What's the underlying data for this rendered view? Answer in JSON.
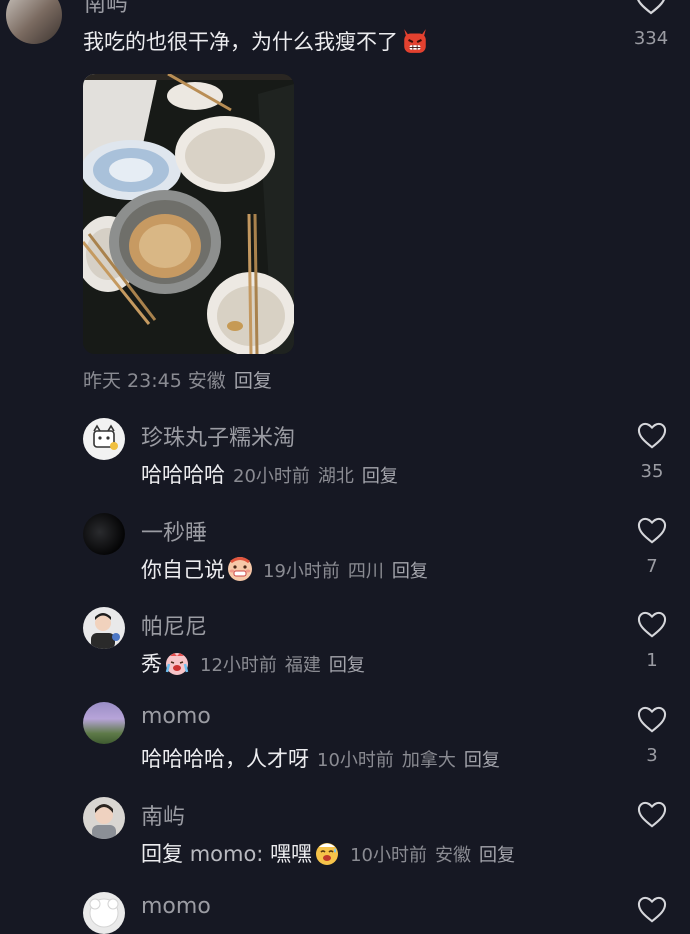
{
  "top_comment": {
    "author": "南屿",
    "text": "我吃的也很干净，为什么我瘦不了",
    "likes": "334",
    "time": "昨天 23:45",
    "location": "安徽",
    "reply_label": "回复"
  },
  "replies": [
    {
      "author": "珍珠丸子糯米淘",
      "text": "哈哈哈哈",
      "time": "20小时前",
      "location": "湖北",
      "reply_label": "回复",
      "likes": "35"
    },
    {
      "author": "一秒睡",
      "text": "你自己说",
      "time": "19小时前",
      "location": "四川",
      "reply_label": "回复",
      "likes": "7"
    },
    {
      "author": "帕尼尼",
      "text": "秀",
      "time": "12小时前",
      "location": "福建",
      "reply_label": "回复",
      "likes": "1"
    },
    {
      "author": "momo",
      "text": "哈哈哈哈，人才呀",
      "time": "10小时前",
      "location": "加拿大",
      "reply_label": "回复",
      "likes": "3"
    },
    {
      "author": "南屿",
      "text_prefix": "回复",
      "text_target": "momo:",
      "text": "嘿嘿",
      "time": "10小时前",
      "location": "安徽",
      "reply_label": "回复",
      "likes": ""
    },
    {
      "author": "momo",
      "text": "",
      "time": "",
      "location": "",
      "reply_label": "",
      "likes": ""
    }
  ],
  "colors": {
    "background": "#161823",
    "name_gray": "#9b9ca3",
    "text": "#ececef"
  },
  "icons": [
    "heart-outline-icon",
    "devil-emoji",
    "grimace-emoji",
    "crying-emoji",
    "sweat-smile-emoji"
  ]
}
